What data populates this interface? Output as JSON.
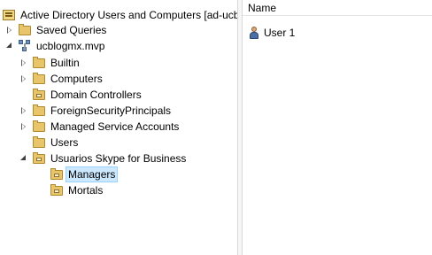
{
  "tree": {
    "root": "Active Directory Users and Computers [ad-ucb",
    "saved_queries": "Saved Queries",
    "domain": "ucblogmx.mvp",
    "builtin": "Builtin",
    "computers": "Computers",
    "domain_controllers": "Domain Controllers",
    "foreign_security_principals": "ForeignSecurityPrincipals",
    "managed_service_accounts": "Managed Service Accounts",
    "users": "Users",
    "usuarios_skype": "Usuarios Skype for Business",
    "managers": "Managers",
    "mortals": "Mortals",
    "selected": "Managers"
  },
  "list": {
    "column_name": "Name",
    "rows": [
      "User 1"
    ]
  }
}
